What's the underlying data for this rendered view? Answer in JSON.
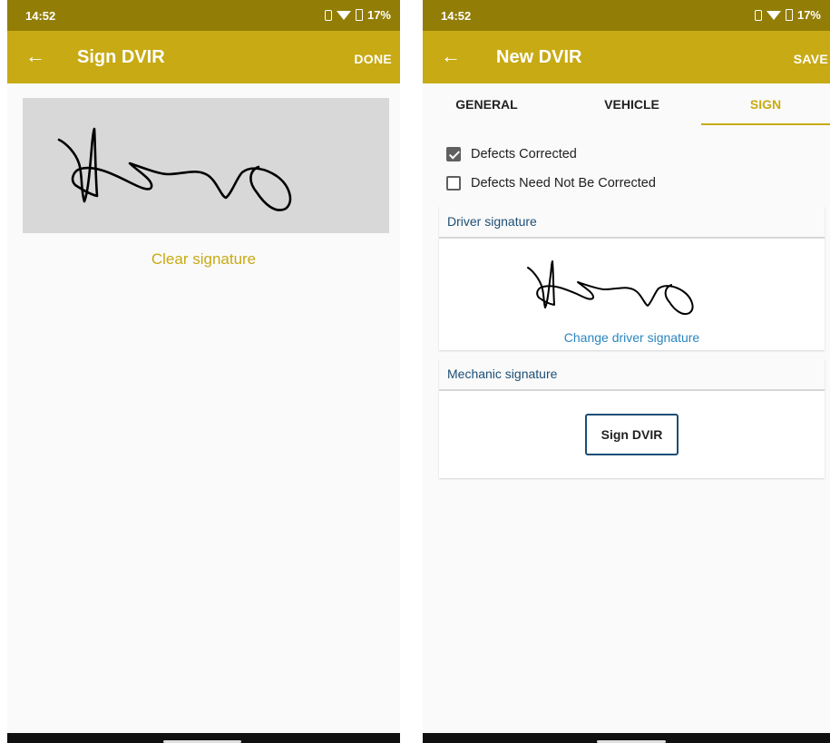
{
  "left_screen": {
    "status_bar": {
      "time": "14:52",
      "battery": "17%"
    },
    "app_bar": {
      "back_icon": "arrow-left-icon",
      "title": "Sign DVIR",
      "action": "DONE"
    },
    "clear_signature": "Clear signature"
  },
  "right_screen": {
    "status_bar": {
      "time": "14:52",
      "battery": "17%"
    },
    "app_bar": {
      "back_icon": "arrow-left-icon",
      "title": "New DVIR",
      "action": "SAVE"
    },
    "tabs": [
      {
        "label": "GENERAL",
        "active": false
      },
      {
        "label": "VEHICLE",
        "active": false
      },
      {
        "label": "SIGN",
        "active": true
      }
    ],
    "checkboxes": [
      {
        "label": "Defects Corrected",
        "checked": true
      },
      {
        "label": "Defects Need Not Be Corrected",
        "checked": false
      }
    ],
    "driver_card": {
      "header": "Driver signature",
      "change_link": "Change driver signature"
    },
    "mechanic_card": {
      "header": "Mechanic signature",
      "sign_button": "Sign DVIR"
    }
  },
  "colors": {
    "status_bar": "#927d06",
    "app_bar": "#c8aa14",
    "accent": "#c8aa14",
    "card_header_text": "#1c4e75",
    "link": "#2a86c0"
  }
}
